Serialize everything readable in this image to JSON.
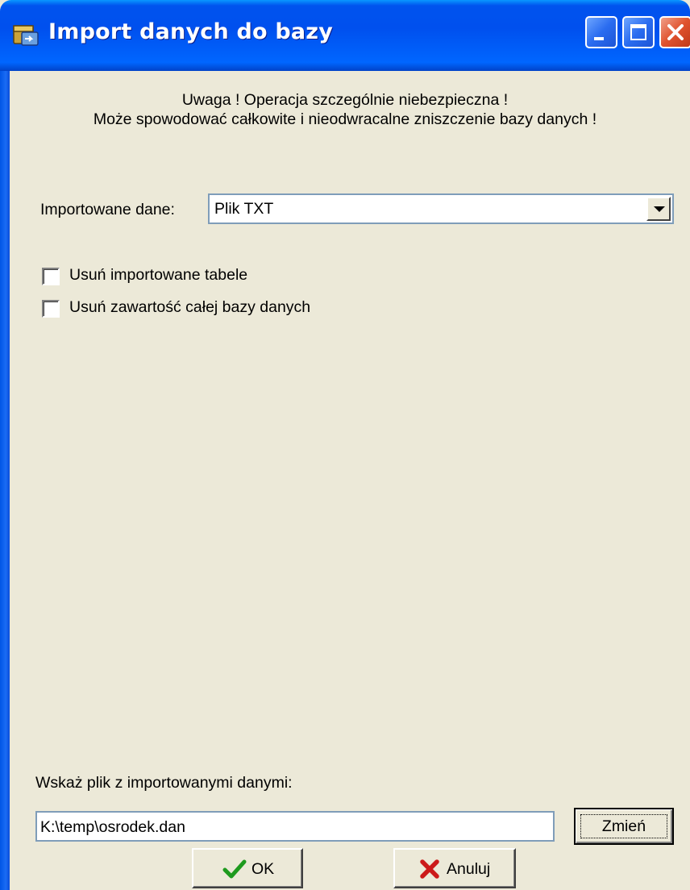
{
  "window": {
    "title": "Import danych do bazy",
    "controls": {
      "minimize": "minimize-icon",
      "maximize": "maximize-icon",
      "close": "close-icon"
    }
  },
  "warning": {
    "line1": "Uwaga ! Operacja szczególnie niebezpieczna !",
    "line2": "Może spowodować całkowite i nieodwracalne zniszczenie bazy danych !"
  },
  "import_type": {
    "label": "Importowane dane:",
    "selected": "Plik TXT"
  },
  "options": [
    {
      "label": "Usuń importowane tabele",
      "checked": false
    },
    {
      "label": "Usuń zawartość całej bazy danych",
      "checked": false
    }
  ],
  "file": {
    "label": "Wskaż plik z importowanymi danymi:",
    "path": "K:\\temp\\osrodek.dan",
    "change_button": "Zmień"
  },
  "actions": {
    "ok": "OK",
    "cancel": "Anuluj"
  },
  "colors": {
    "titlebar": "#0054e3",
    "body": "#ece9d8",
    "ok_check": "#1e9a1e",
    "cancel_x": "#cc1a1a"
  }
}
